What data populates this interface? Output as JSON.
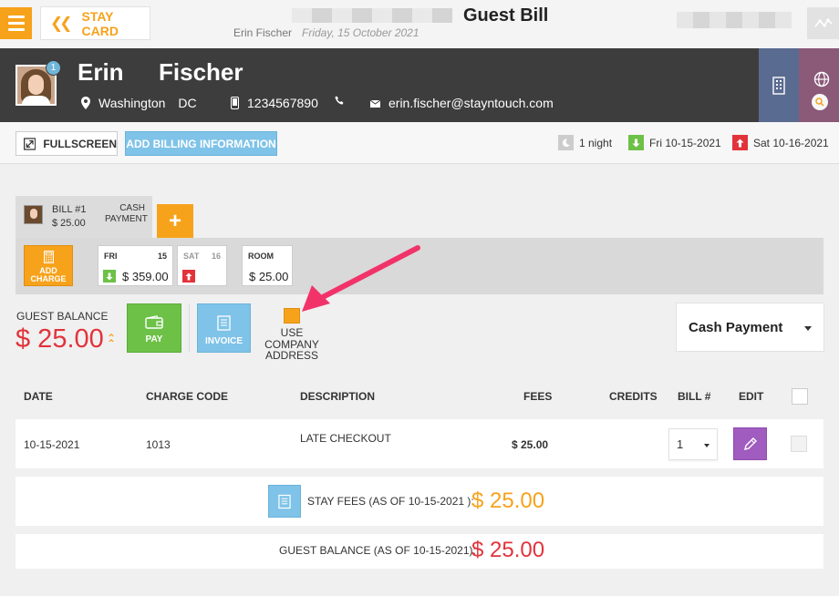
{
  "header": {
    "stay_card_label": "STAY CARD",
    "title": "Guest Bill",
    "guest_name_sub": "Erin Fischer",
    "date_sub": "Friday, 15 October 2021"
  },
  "guest": {
    "first_name": "Erin",
    "last_name": "Fischer",
    "badge_count": "1",
    "city": "Washington",
    "state": "DC",
    "phone": "1234567890",
    "email": "erin.fischer@stayntouch.com"
  },
  "toolbar": {
    "fullscreen_label": "FULLSCREEN",
    "add_billing_label": "ADD BILLING INFORMATION",
    "nights": "1 night",
    "arrival": "Fri 10-15-2021",
    "departure": "Sat 10-16-2021"
  },
  "bill_tab": {
    "bill_no": "BILL #1",
    "amount": "$ 25.00",
    "payment_line1": "CASH",
    "payment_line2": "PAYMENT",
    "add_label": "+"
  },
  "add_charge": {
    "line1": "ADD",
    "line2": "CHARGE"
  },
  "date_cards": [
    {
      "day": "FRI",
      "num": "15",
      "amount": "$ 359.00"
    },
    {
      "day": "SAT",
      "num": "16",
      "amount": ""
    },
    {
      "day": "ROOM",
      "num": "",
      "amount": "$ 25.00"
    }
  ],
  "balance": {
    "label": "GUEST BALANCE",
    "value": "$ 25.00",
    "pay_label": "PAY",
    "invoice_label": "INVOICE",
    "use_company_line1": "USE",
    "use_company_line2": "COMPANY",
    "use_company_line3": "ADDRESS",
    "payment_method": "Cash Payment"
  },
  "table": {
    "headers": {
      "date": "DATE",
      "charge_code": "CHARGE CODE",
      "description": "DESCRIPTION",
      "fees": "FEES",
      "credits": "CREDITS",
      "bill": "BILL #",
      "edit": "EDIT"
    },
    "rows": [
      {
        "date": "10-15-2021",
        "charge_code": "1013",
        "description": "LATE CHECKOUT",
        "fees": "$ 25.00",
        "credits": "",
        "bill": "1"
      }
    ]
  },
  "summary": {
    "stay_fees_label": "STAY FEES (AS OF 10-15-2021 ):",
    "stay_fees_value": "$ 25.00",
    "guest_balance_label": "GUEST BALANCE (AS OF 10-15-2021):",
    "guest_balance_value": "$ 25.00"
  },
  "colors": {
    "accent_orange": "#f7a21b",
    "balance_red": "#e2333b",
    "pay_green": "#6dc147",
    "info_blue": "#7fc3e8",
    "edit_purple": "#a05cbf",
    "annotation_pink": "#f2336a"
  }
}
